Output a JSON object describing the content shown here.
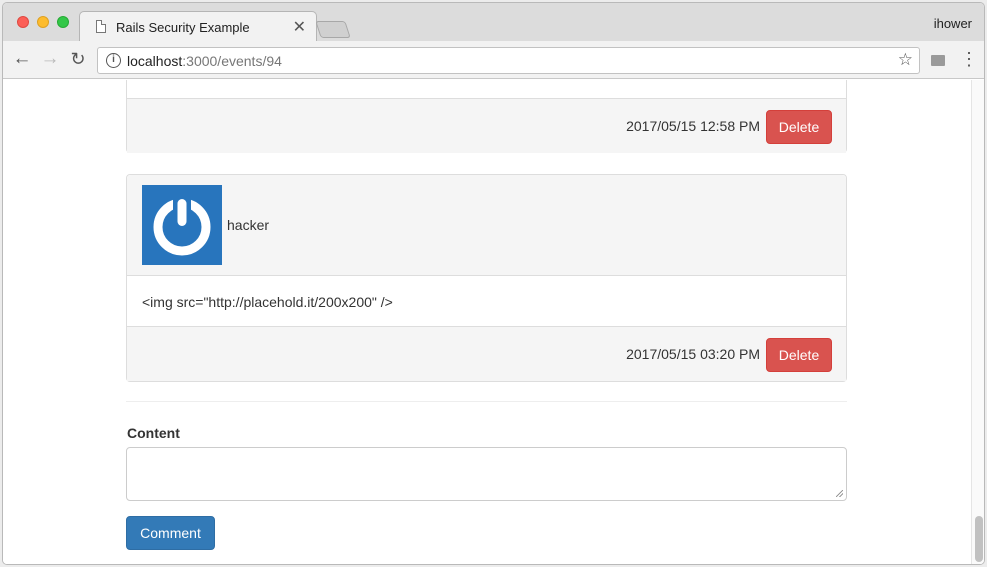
{
  "browser": {
    "tab_title": "Rails Security Example",
    "tab_close": "✕",
    "profile_name": "ihower",
    "url_host": "localhost",
    "url_path": ":3000/events/94"
  },
  "icons": {
    "back": "←",
    "forward": "→",
    "reload": "↻",
    "info": "i",
    "star": "☆",
    "menu": "⋮"
  },
  "comments": [
    {
      "timestamp": "2017/05/15 12:58 PM",
      "delete_label": "Delete"
    },
    {
      "author": "hacker",
      "content": "<img src=\"http://placehold.it/200x200\" />",
      "timestamp": "2017/05/15 03:20 PM",
      "delete_label": "Delete"
    }
  ],
  "form": {
    "content_label": "Content",
    "content_value": "",
    "submit_label": "Comment"
  },
  "colors": {
    "danger": "#d9534f",
    "primary": "#337ab7",
    "avatar_bg": "#2875bd"
  }
}
